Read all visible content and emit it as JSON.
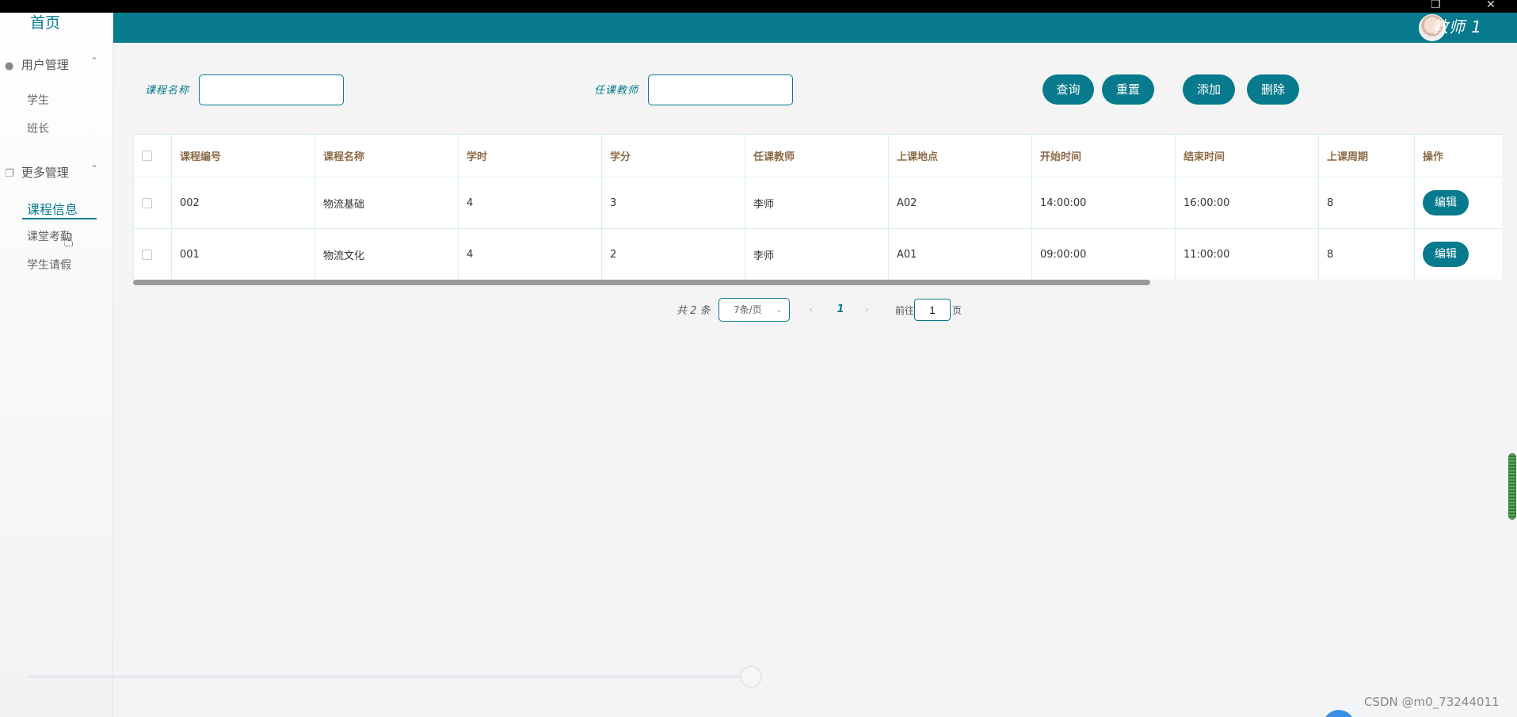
{
  "window": {
    "restore_icon": "restore-icon",
    "close_icon": "close-icon"
  },
  "header": {
    "user_name": "教师 1",
    "avatar_icon": "avatar-icon"
  },
  "sidebar": {
    "home": "首页",
    "groups": [
      {
        "label": "用户管理",
        "icon": "user-icon",
        "items": [
          "学生",
          "班长"
        ]
      },
      {
        "label": "更多管理",
        "icon": "copy-icon",
        "items": [
          "课程信息",
          "课堂考勤",
          "学生请假"
        ]
      }
    ],
    "active_item": "课程信息"
  },
  "search": {
    "course_name_label": "课程名称",
    "course_name_value": "",
    "teacher_label": "任课教师",
    "teacher_value": "",
    "query_btn": "查询",
    "reset_btn": "重置",
    "add_btn": "添加",
    "delete_btn": "删除"
  },
  "table": {
    "headers": [
      "课程编号",
      "课程名称",
      "学时",
      "学分",
      "任课教师",
      "上课地点",
      "开始时间",
      "结束时间",
      "上课周期",
      "操作"
    ],
    "rows": [
      {
        "id": "002",
        "name": "物流基础",
        "hours": "4",
        "credit": "3",
        "teacher": "李师",
        "place": "A02",
        "start": "14:00:00",
        "end": "16:00:00",
        "cycle": "8",
        "action": "编辑"
      },
      {
        "id": "001",
        "name": "物流文化",
        "hours": "4",
        "credit": "2",
        "teacher": "李师",
        "place": "A01",
        "start": "09:00:00",
        "end": "11:00:00",
        "cycle": "8",
        "action": "编辑"
      }
    ]
  },
  "pagination": {
    "total": "共 2 条",
    "page_size": "7条/页",
    "current_page": "1",
    "goto_label": "前往",
    "goto_value": "1",
    "page_suffix": "页"
  },
  "watermark": "CSDN @m0_73244011",
  "colors": {
    "accent": "#077a8d",
    "header_text_color": "#8c6b46"
  }
}
